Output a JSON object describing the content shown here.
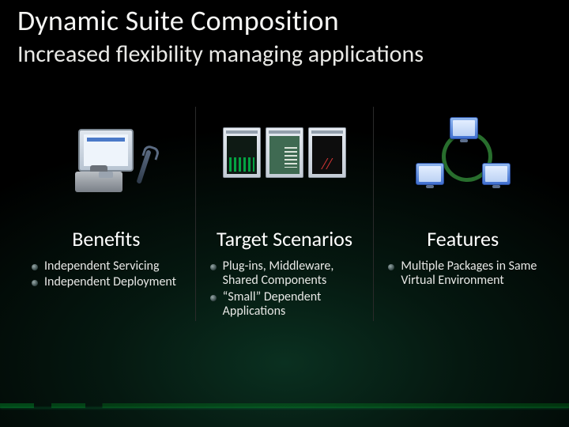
{
  "title": "Dynamic Suite Composition",
  "subtitle": "Increased flexibility managing applications",
  "columns": [
    {
      "heading": "Benefits",
      "bullets": [
        "Independent Servicing",
        "Independent Deployment"
      ]
    },
    {
      "heading": "Target Scenarios",
      "bullets": [
        "Plug-ins, Middleware, Shared Components",
        "“Small” Dependent Applications"
      ]
    },
    {
      "heading": "Features",
      "bullets": [
        "Multiple Packages in Same Virtual Environment"
      ]
    }
  ]
}
